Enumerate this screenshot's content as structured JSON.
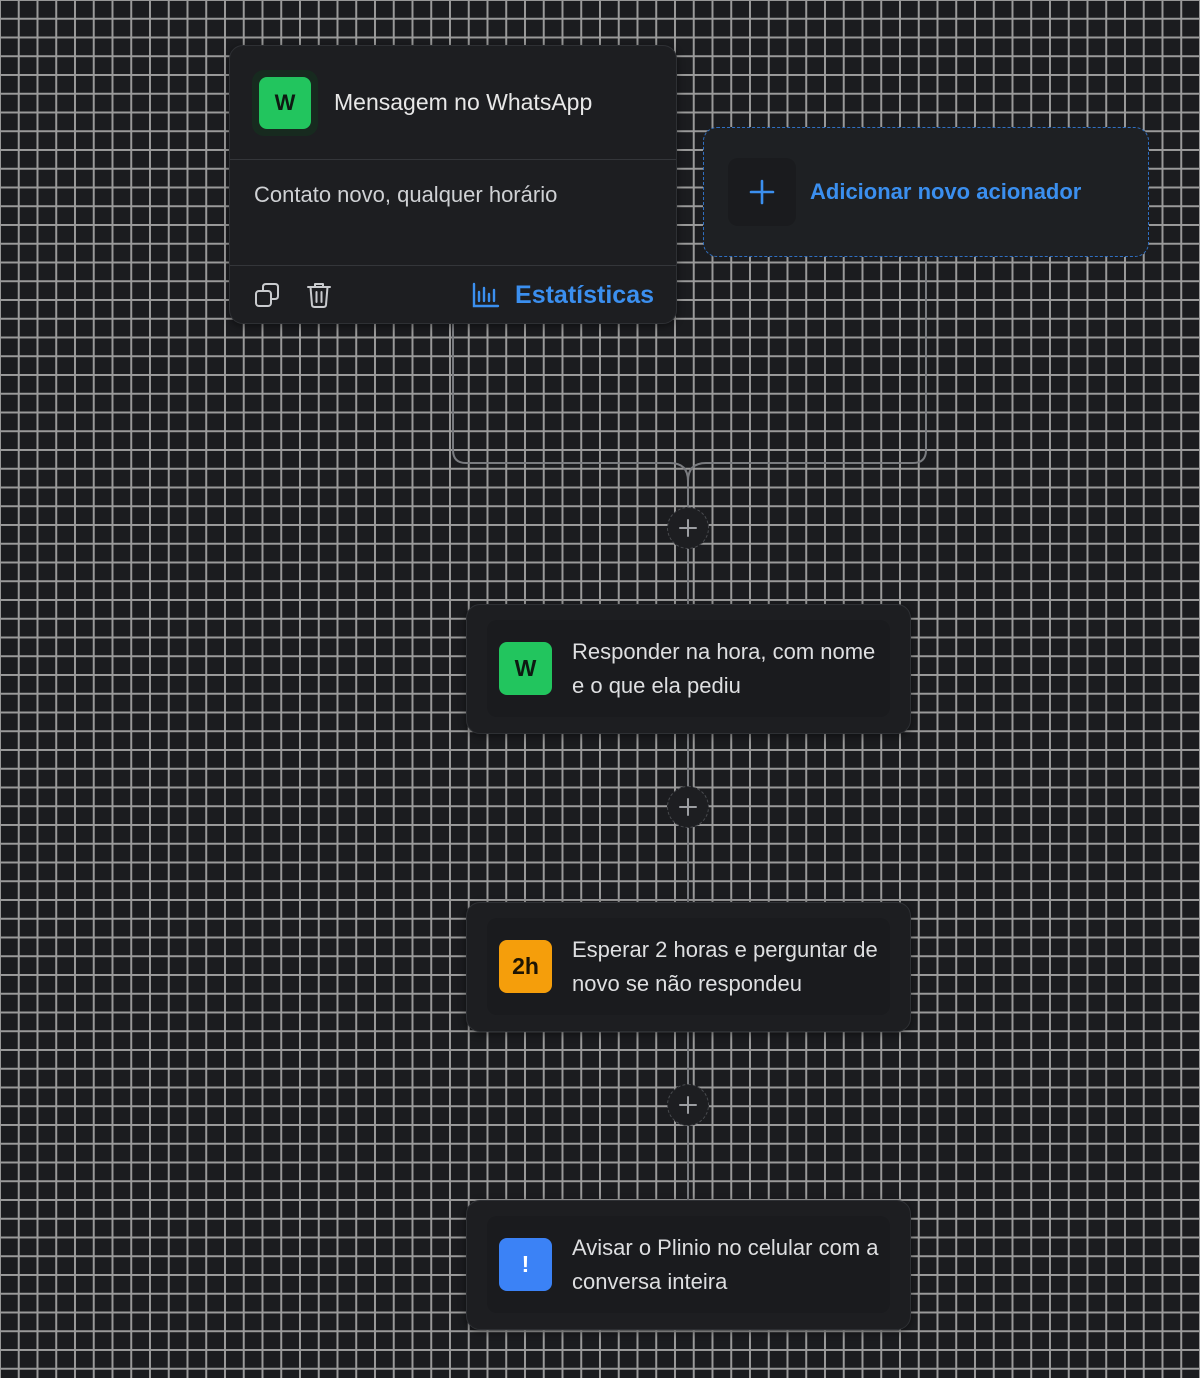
{
  "trigger": {
    "icon_letter": "W",
    "title": "Mensagem no WhatsApp",
    "description": "Contato novo, qualquer horário",
    "stats_label": "Estatísticas"
  },
  "add_trigger": {
    "label": "Adicionar novo acionador"
  },
  "steps": [
    {
      "badge": "W",
      "badge_color": "#22c55e",
      "text": "Responder na hora, com nome e o que ela pediu"
    },
    {
      "badge": "2h",
      "badge_color": "#f59e0b",
      "text": "Esperar 2 horas e perguntar de novo se não respondeu"
    },
    {
      "badge": "!",
      "badge_color": "#3b82f6",
      "text": "Avisar o Plinio no celular com a conversa inteira"
    }
  ],
  "colors": {
    "accent": "#3b8fef",
    "whatsapp": "#22c55e",
    "wait": "#f59e0b",
    "notify": "#3b82f6"
  }
}
